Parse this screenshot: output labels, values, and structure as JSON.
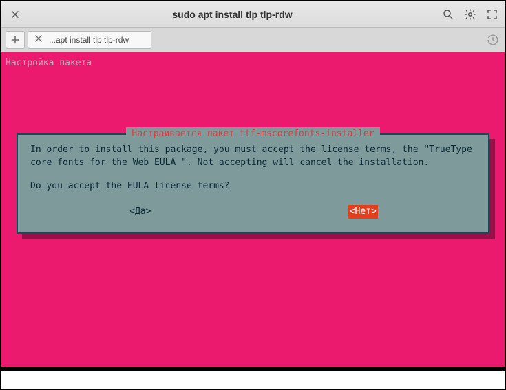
{
  "window": {
    "title": "sudo apt install tlp tlp-rdw"
  },
  "tab": {
    "label": "...apt install tlp tlp-rdw"
  },
  "terminal": {
    "status": "Настройка пакета"
  },
  "dialog": {
    "title": "Настраивается пакет ttf-mscorefonts-installer",
    "body": "In order to install this package, you must accept the license terms, the \"TrueType core fonts for the Web EULA \". Not accepting will cancel the installation.",
    "question": "Do you accept the EULA license terms?",
    "yes": "<Да>",
    "no": "<Нет>"
  }
}
